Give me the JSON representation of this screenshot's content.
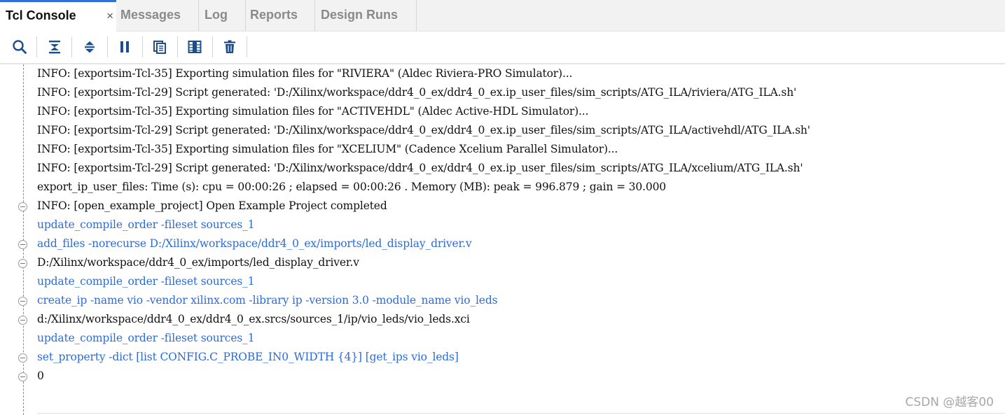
{
  "tabs": [
    {
      "label": "Tcl Console",
      "active": true,
      "close": "×"
    },
    {
      "label": "Messages"
    },
    {
      "label": "Log"
    },
    {
      "label": "Reports"
    },
    {
      "label": "Design Runs"
    }
  ],
  "toolbar": {
    "buttons": [
      "search-icon",
      "collapse-all-icon",
      "expand-all-icon",
      "pause-icon",
      "copy-icon",
      "columns-icon",
      "trash-icon"
    ]
  },
  "console": {
    "lines": [
      {
        "text": "INFO: [exportsim-Tcl-35] Exporting simulation files for \"RIVIERA\" (Aldec Riviera-PRO Simulator)...",
        "type": "info"
      },
      {
        "text": "INFO: [exportsim-Tcl-29] Script generated: 'D:/Xilinx/workspace/ddr4_0_ex/ddr4_0_ex.ip_user_files/sim_scripts/ATG_ILA/riviera/ATG_ILA.sh'",
        "type": "info"
      },
      {
        "text": "INFO: [exportsim-Tcl-35] Exporting simulation files for \"ACTIVEHDL\" (Aldec Active-HDL Simulator)...",
        "type": "info"
      },
      {
        "text": "INFO: [exportsim-Tcl-29] Script generated: 'D:/Xilinx/workspace/ddr4_0_ex/ddr4_0_ex.ip_user_files/sim_scripts/ATG_ILA/activehdl/ATG_ILA.sh'",
        "type": "info"
      },
      {
        "text": "INFO: [exportsim-Tcl-35] Exporting simulation files for \"XCELIUM\" (Cadence Xcelium Parallel Simulator)...",
        "type": "info"
      },
      {
        "text": "INFO: [exportsim-Tcl-29] Script generated: 'D:/Xilinx/workspace/ddr4_0_ex/ddr4_0_ex.ip_user_files/sim_scripts/ATG_ILA/xcelium/ATG_ILA.sh'",
        "type": "info"
      },
      {
        "text": "export_ip_user_files: Time (s): cpu = 00:00:26 ; elapsed = 00:00:26 . Memory (MB): peak = 996.879 ; gain = 30.000",
        "type": "info"
      },
      {
        "text": "INFO: [open_example_project] Open Example Project completed",
        "type": "info",
        "fold": true
      },
      {
        "text": "update_compile_order -fileset sources_1",
        "type": "cmd"
      },
      {
        "text": "add_files -norecurse D:/Xilinx/workspace/ddr4_0_ex/imports/led_display_driver.v",
        "type": "cmd",
        "fold": true
      },
      {
        "text": "D:/Xilinx/workspace/ddr4_0_ex/imports/led_display_driver.v",
        "type": "output",
        "fold": true
      },
      {
        "text": "update_compile_order -fileset sources_1",
        "type": "cmd"
      },
      {
        "text": "create_ip -name vio -vendor xilinx.com -library ip -version 3.0 -module_name vio_leds",
        "type": "cmd",
        "fold": true
      },
      {
        "text": "d:/Xilinx/workspace/ddr4_0_ex/ddr4_0_ex.srcs/sources_1/ip/vio_leds/vio_leds.xci",
        "type": "output",
        "fold": true
      },
      {
        "text": "update_compile_order -fileset sources_1",
        "type": "cmd"
      },
      {
        "text": "set_property -dict [list CONFIG.C_PROBE_IN0_WIDTH {4}] [get_ips vio_leds]",
        "type": "cmd",
        "fold": true
      },
      {
        "text": "0",
        "type": "output",
        "fold": true
      }
    ]
  },
  "watermark": "CSDN @越客00",
  "colors": {
    "accent": "#2f6fd6",
    "command_text": "#2d6cd8",
    "icon": "#1f4e8c"
  }
}
